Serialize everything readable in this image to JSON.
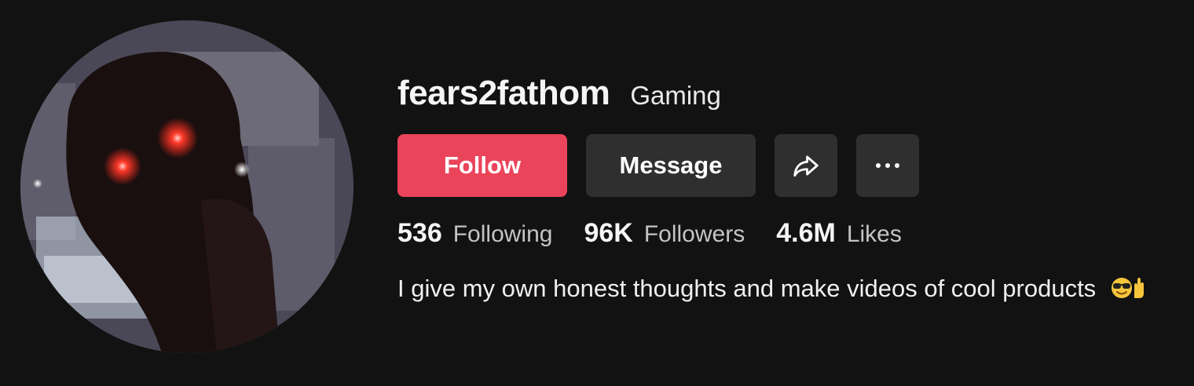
{
  "profile": {
    "username": "fears2fathom",
    "category": "Gaming",
    "bio": "I give my own honest thoughts and make videos of cool products",
    "bio_emojis": [
      "sunglasses-face-emoji",
      "raised-hand-emoji"
    ]
  },
  "actions": {
    "follow_label": "Follow",
    "message_label": "Message",
    "share_icon": "share-icon",
    "more_icon": "more-icon"
  },
  "stats": {
    "following": {
      "value": "536",
      "label": "Following"
    },
    "followers": {
      "value": "96K",
      "label": "Followers"
    },
    "likes": {
      "value": "4.6M",
      "label": "Likes"
    }
  },
  "colors": {
    "background": "#121212",
    "follow_button": "#ea445a",
    "secondary_button": "#2f2f2f"
  }
}
